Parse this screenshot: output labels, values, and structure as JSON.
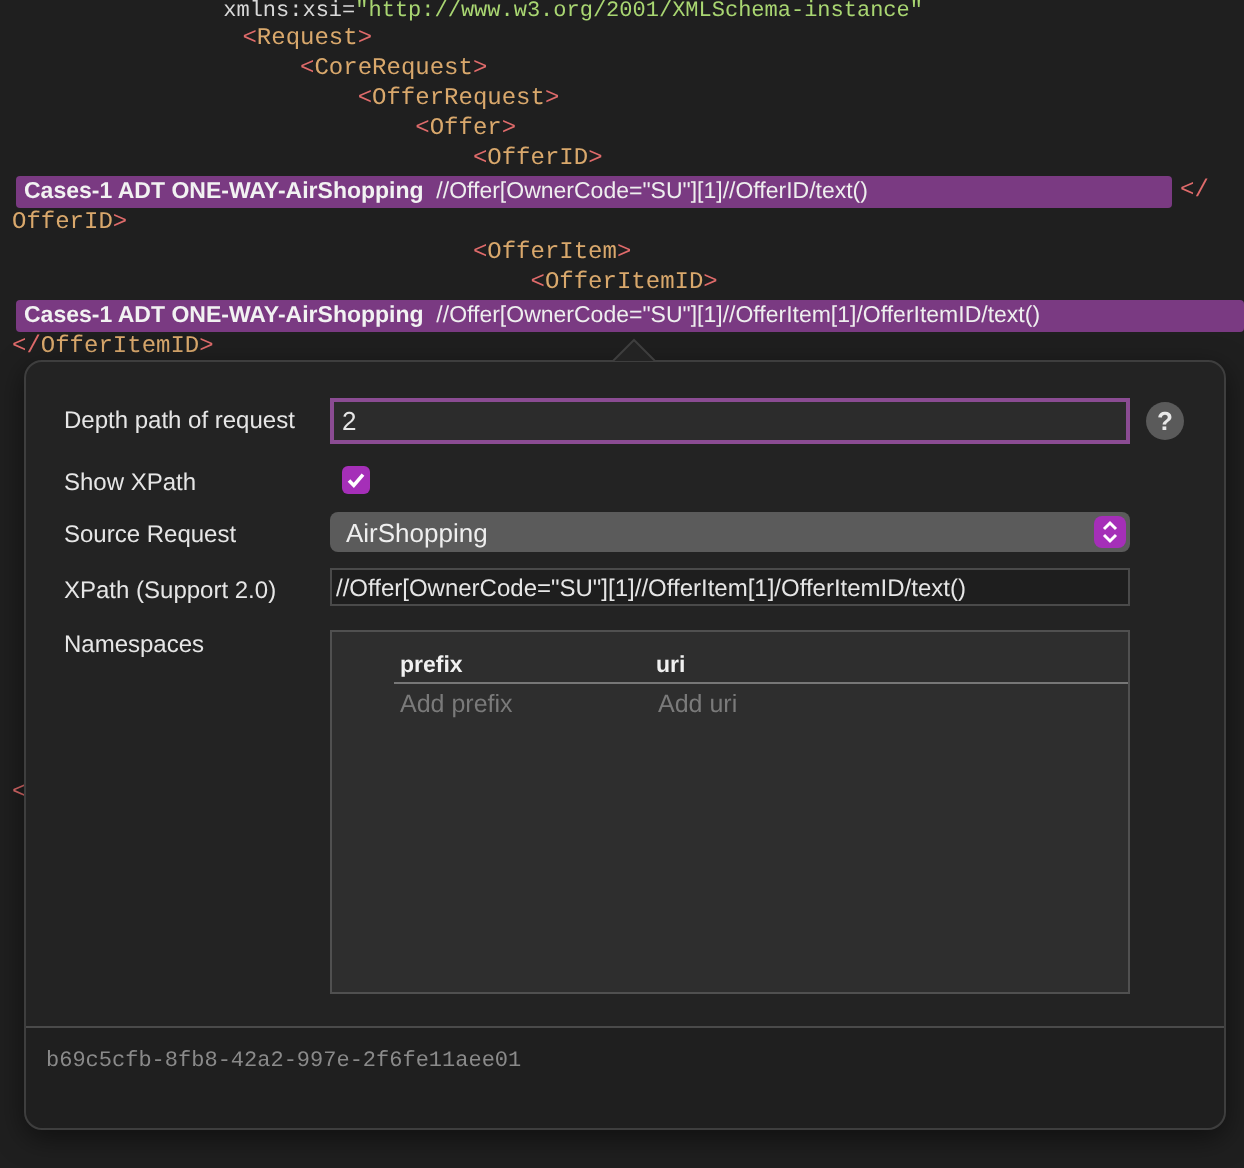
{
  "editor": {
    "lines": [
      {
        "kind": "code",
        "parts": [
          {
            "kind": "attr",
            "text": "                xmlns:xsi="
          },
          {
            "kind": "string",
            "text": "\"http://www.w3.org/2001/XMLSchema-instance\""
          }
        ]
      },
      {
        "kind": "code",
        "parts": [
          {
            "kind": "punct",
            "text": "                <"
          },
          {
            "kind": "tag",
            "text": "Request"
          },
          {
            "kind": "punct",
            "text": ">"
          }
        ]
      },
      {
        "kind": "code",
        "parts": [
          {
            "kind": "punct",
            "text": "                    <"
          },
          {
            "kind": "tag",
            "text": "CoreRequest"
          },
          {
            "kind": "punct",
            "text": ">"
          }
        ]
      },
      {
        "kind": "code",
        "parts": [
          {
            "kind": "punct",
            "text": "                        <"
          },
          {
            "kind": "tag",
            "text": "OfferRequest"
          },
          {
            "kind": "punct",
            "text": ">"
          }
        ]
      },
      {
        "kind": "code",
        "parts": [
          {
            "kind": "punct",
            "text": "                            <"
          },
          {
            "kind": "tag",
            "text": "Offer"
          },
          {
            "kind": "punct",
            "text": ">"
          }
        ]
      },
      {
        "kind": "code",
        "parts": [
          {
            "kind": "punct",
            "text": "                                <"
          },
          {
            "kind": "tag",
            "text": "OfferID"
          },
          {
            "kind": "punct",
            "text": ">"
          }
        ]
      },
      {
        "kind": "annotation",
        "label": "Cases-1 ADT ONE-WAY-AirShopping",
        "xpath": "//Offer[OwnerCode=\"SU\"][1]//OfferID/text()",
        "after": "</"
      },
      {
        "kind": "code",
        "parts": [
          {
            "kind": "tag",
            "text": "OfferID"
          },
          {
            "kind": "punct",
            "text": ">"
          }
        ]
      },
      {
        "kind": "code",
        "parts": [
          {
            "kind": "punct",
            "text": "                                <"
          },
          {
            "kind": "tag",
            "text": "OfferItem"
          },
          {
            "kind": "punct",
            "text": ">"
          }
        ]
      },
      {
        "kind": "code",
        "parts": [
          {
            "kind": "punct",
            "text": "                                    <"
          },
          {
            "kind": "tag",
            "text": "OfferItemID"
          },
          {
            "kind": "punct",
            "text": ">"
          }
        ]
      },
      {
        "kind": "annotation",
        "label": "Cases-1 ADT ONE-WAY-AirShopping",
        "xpath": "//Offer[OwnerCode=\"SU\"][1]//OfferItem[1]/OfferItemID/text()"
      },
      {
        "kind": "code",
        "parts": [
          {
            "kind": "punct",
            "text": "</"
          },
          {
            "kind": "tag",
            "text": "OfferItemID"
          },
          {
            "kind": "punct",
            "text": ">"
          }
        ]
      },
      {
        "kind": "gap"
      },
      {
        "kind": "code",
        "parts": [
          {
            "kind": "punct",
            "text": "<"
          }
        ]
      }
    ]
  },
  "popover": {
    "depth": {
      "label": "Depth path of request",
      "value": "2",
      "focused": true,
      "help": "?"
    },
    "show_xpath": {
      "label": "Show XPath",
      "checked": true
    },
    "source_request": {
      "label": "Source Request",
      "value": "AirShopping"
    },
    "xpath": {
      "label": "XPath (Support 2.0)",
      "value": "//Offer[OwnerCode=\"SU\"][1]//OfferItem[1]/OfferItemID/text()"
    },
    "namespaces": {
      "label": "Namespaces",
      "columns": [
        "prefix",
        "uri"
      ],
      "placeholders": [
        "Add prefix",
        "Add uri"
      ]
    },
    "id": "b69c5cfb-8fb8-42a2-997e-2f6fe11aee01"
  }
}
